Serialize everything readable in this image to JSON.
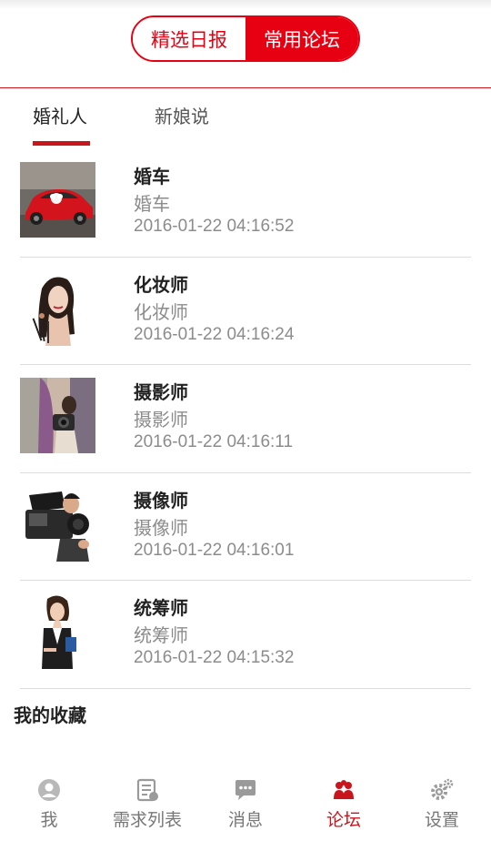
{
  "header": {
    "segments": [
      {
        "label": "精选日报",
        "active": false
      },
      {
        "label": "常用论坛",
        "active": true
      }
    ]
  },
  "subtabs": [
    {
      "label": "婚礼人",
      "active": true
    },
    {
      "label": "新娘说",
      "active": false
    }
  ],
  "items": [
    {
      "title": "婚车",
      "subtitle": "婚车",
      "time": "2016-01-22 04:16:52",
      "image": "wedding-car"
    },
    {
      "title": "化妆师",
      "subtitle": "化妆师",
      "time": "2016-01-22 04:16:24",
      "image": "makeup-artist"
    },
    {
      "title": "摄影师",
      "subtitle": "摄影师",
      "time": "2016-01-22 04:16:11",
      "image": "photographer"
    },
    {
      "title": "摄像师",
      "subtitle": "摄像师",
      "time": "2016-01-22 04:16:01",
      "image": "videographer"
    },
    {
      "title": "统筹师",
      "subtitle": "统筹师",
      "time": "2016-01-22 04:15:32",
      "image": "coordinator"
    }
  ],
  "favorites": {
    "title": "我的收藏"
  },
  "nav": [
    {
      "label": "我",
      "icon": "user-icon",
      "active": false
    },
    {
      "label": "需求列表",
      "icon": "list-icon",
      "active": false
    },
    {
      "label": "消息",
      "icon": "message-icon",
      "active": false
    },
    {
      "label": "论坛",
      "icon": "forum-icon",
      "active": true
    },
    {
      "label": "设置",
      "icon": "settings-gear-icon",
      "active": false
    }
  ],
  "colors": {
    "accent": "#e60012",
    "divider": "#dcdcdc",
    "muted": "#8c8c8c"
  }
}
